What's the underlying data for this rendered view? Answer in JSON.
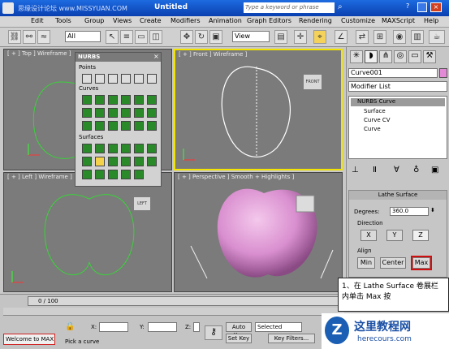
{
  "titlebar": {
    "title": "Untitled",
    "search_placeholder": "Type a keyword or phrase",
    "watermark": "思缘设计论坛 www.MISSYUAN.COM"
  },
  "menu": [
    "Edit",
    "Tools",
    "Group",
    "Views",
    "Create",
    "Modifiers",
    "Animation",
    "Graph Editors",
    "Rendering",
    "Customize",
    "MAXScript",
    "Help"
  ],
  "toolbar": {
    "filter": "All",
    "coord": "View"
  },
  "viewports": {
    "top": "[ + ] Top ] Wireframe ]",
    "front": "[ + ] Front ] Wireframe ]",
    "left": "[ + ] Left ] Wireframe ]",
    "persp": "[ + ] Perspective ] Smooth + Highlights ]"
  },
  "viewcube": {
    "front": "FRONT",
    "left": "LEFT"
  },
  "nurbs": {
    "title": "NURBS",
    "points": "Points",
    "curves": "Curves",
    "surfaces": "Surfaces"
  },
  "cmdpanel": {
    "object_name": "Curve001",
    "modifier_list": "Modifier List",
    "stack": [
      "NURBS Curve",
      "Surface",
      "Curve CV",
      "Curve"
    ]
  },
  "lathe": {
    "title": "Lathe Surface",
    "degrees_label": "Degrees:",
    "degrees_value": "360.0",
    "direction": "Direction",
    "x": "X",
    "y": "Y",
    "z": "Z",
    "align": "Align",
    "min": "Min",
    "center": "Center",
    "max": "Max"
  },
  "timeline": {
    "frame": "0 / 100"
  },
  "status": {
    "welcome": "Welcome to MAX",
    "prompt": "Pick a curve",
    "x_label": "X:",
    "y_label": "Y:",
    "z_label": "Z:",
    "autokey": "Auto Key",
    "setkey": "Set Key",
    "selected": "Selected",
    "keyfilters": "Key Filters..."
  },
  "annotation": {
    "text": "1、在 Lathe Surface 卷展栏内单击 Max 按"
  },
  "logo": {
    "brand": "这里教程网",
    "url": "herecours.com"
  }
}
